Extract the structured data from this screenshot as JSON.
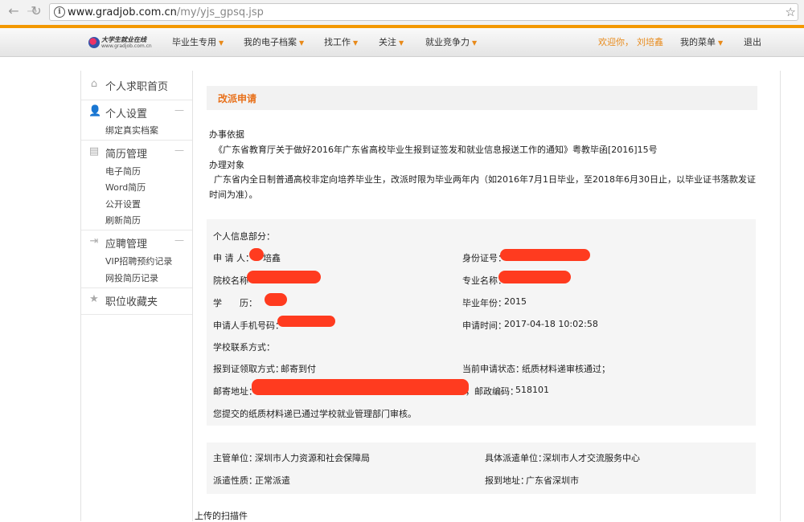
{
  "browser": {
    "url_host": "www.gradjob.com.cn",
    "url_path": "/my/yjs_gpsq.jsp"
  },
  "header": {
    "logo_text": "大学生就业在线",
    "logo_url": "www.gradjob.com.cn",
    "nav": [
      "毕业生专用",
      "我的电子档案",
      "找工作",
      "关注",
      "就业竞争力"
    ],
    "welcome": "欢迎你，",
    "user_name": "刘培鑫",
    "my_menu": "我的菜单",
    "logout": "退出"
  },
  "sidebar": {
    "home": "个人求职首页",
    "settings": "个人设置",
    "settings_items": [
      "绑定真实档案"
    ],
    "resume": "简历管理",
    "resume_items": [
      "电子简历",
      "Word简历",
      "公开设置",
      "刷新简历"
    ],
    "apply": "应聘管理",
    "apply_items": [
      "VIP招聘预约记录",
      "网投简历记录"
    ],
    "favorites": "职位收藏夹"
  },
  "main": {
    "title": "改派申请",
    "basis_label": "办事依据",
    "basis_text": "《广东省教育厅关于做好2016年广东省高校毕业生报到证签发和就业信息报送工作的通知》粤教毕函[2016]15号",
    "target_label": "办理对象",
    "target_text": "广东省内全日制普通高校非定向培养毕业生，改派时限为毕业两年内（如2016年7月1日毕业，至2018年6月30日止，以毕业证书落款发证时间为准）。",
    "info_header": "个人信息部分：",
    "applicant_label": "申 请 人：",
    "applicant_value": "培鑫",
    "id_label": "身份证号：",
    "school_label": "院校名称",
    "major_label": "专业名称：",
    "edu_label": "学　　历：",
    "grad_year_label": "毕业年份：",
    "grad_year_value": "2015",
    "phone_label": "申请人手机号码：",
    "apply_time_label": "申请时间：",
    "apply_time_value": "2017-04-18 10:02:58",
    "contact_label": "学校联系方式：",
    "receive_label": "报到证领取方式：",
    "receive_value": "邮寄到付",
    "status_label": "当前申请状态：",
    "status_value": "纸质材料递审核通过；",
    "mail_label": "邮寄地址：",
    "postcode_label": "，邮政编码：",
    "postcode_value": "518101",
    "notice": "您提交的纸质材料递已通过学校就业管理部门审核。",
    "dept_label": "主管单位：",
    "dept_value": "深圳市人力资源和社会保障局",
    "dispatch_unit_label": "具体派遣单位：",
    "dispatch_unit_value": "深圳市人才交流服务中心",
    "dispatch_type_label": "派遣性质：",
    "dispatch_type_value": "正常派遣",
    "report_addr_label": "报到地址：",
    "report_addr_value": "广东省深圳市",
    "uploaded_label": "上传的扫描件"
  }
}
